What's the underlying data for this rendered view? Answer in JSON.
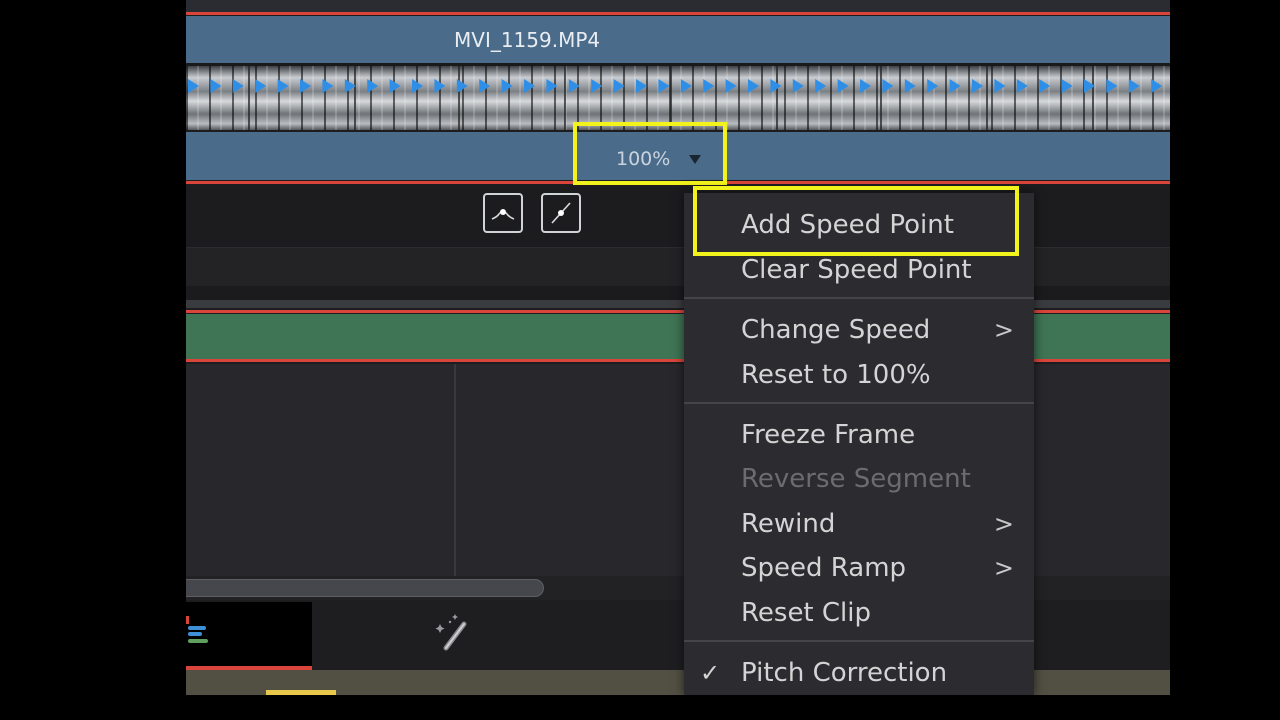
{
  "clip": {
    "name": "MVI_1159.MP4",
    "speed_label": "100%",
    "speed_caret_icon": "caret-down-icon"
  },
  "curve_buttons": [
    {
      "icon": "curve-ease-icon"
    },
    {
      "icon": "curve-linear-icon"
    }
  ],
  "context_menu": {
    "items": [
      {
        "label": "Add Speed Point",
        "enabled": true,
        "highlighted": true
      },
      {
        "label": "Clear Speed Point",
        "enabled": true
      },
      {
        "label": "Change Speed",
        "enabled": true,
        "submenu": true
      },
      {
        "label": "Reset to 100%",
        "enabled": true
      },
      {
        "label": "Freeze Frame",
        "enabled": true
      },
      {
        "label": "Reverse Segment",
        "enabled": false
      },
      {
        "label": "Rewind",
        "enabled": true,
        "submenu": true
      },
      {
        "label": "Speed Ramp",
        "enabled": true,
        "submenu": true
      },
      {
        "label": "Reset Clip",
        "enabled": true
      },
      {
        "label": "Pitch Correction",
        "enabled": true,
        "checked": true
      }
    ],
    "submenu_glyph": ">",
    "check_glyph": "✓"
  },
  "colors": {
    "highlight": "#f2f21c",
    "clip_blue": "#4a6b8a",
    "audio_green": "#3f7454",
    "clip_border_red": "#d9453b",
    "speed_arrow_blue": "#2f8fe6"
  }
}
